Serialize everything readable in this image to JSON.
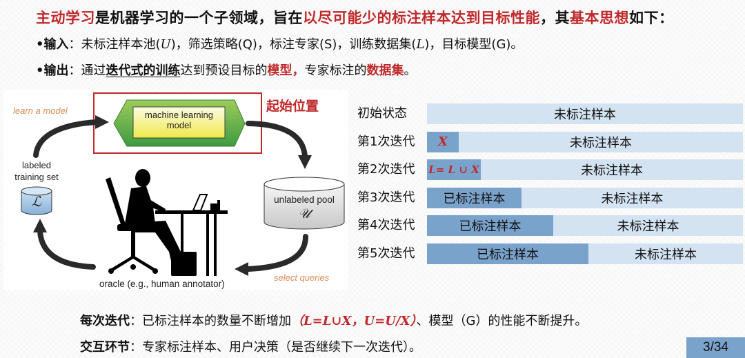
{
  "title": {
    "part1": "主动学习",
    "part2": "是机器学习的一个子领域，旨在",
    "part3": "以尽可能少的标注样本达到目标性能",
    "part4": "，其",
    "part5": "基本思想",
    "part6": "如下："
  },
  "input": {
    "bullet": "•",
    "label": "输入",
    "colon": "：",
    "text1": "未标注样本池(",
    "sym_u": "U",
    "text2": ")，筛选策略(Q)，标注专家(S)，训练数据集(",
    "sym_l": "L",
    "text3": ")，目标模型(G)。"
  },
  "output": {
    "bullet": "•",
    "label": "输出",
    "colon": "：",
    "text1": "通过",
    "underlined": "迭代式的训练",
    "text2": "达到预设目标的",
    "red1": "模型，",
    "text3": "专家标注的",
    "red2": "数据集",
    "text4": "。"
  },
  "diagram": {
    "learn_a_model": "learn a model",
    "model_label_line1": "machine learning",
    "model_label_line2": "model",
    "start_position": "起始位置",
    "labeled_line1": "labeled",
    "labeled_line2": "training set",
    "labeled_symbol": "ℒ",
    "unlabeled_label": "unlabeled pool",
    "unlabeled_symbol": "𝒰",
    "select_queries": "select queries",
    "oracle": "oracle (e.g., human annotator)"
  },
  "iterations": {
    "labeled_text": "已标注样本",
    "unlabeled_text": "未标注样本",
    "rows": [
      {
        "label": "初始状态",
        "labeled_fraction": 0.0,
        "labeled_content": ""
      },
      {
        "label": "第1次迭代",
        "labeled_fraction": 0.1,
        "labeled_content": "X"
      },
      {
        "label": "第2次迭代",
        "labeled_fraction": 0.17,
        "labeled_content": "L= L ∪ X"
      },
      {
        "label": "第3次迭代",
        "labeled_fraction": 0.3,
        "labeled_content": "已标注样本"
      },
      {
        "label": "第4次迭代",
        "labeled_fraction": 0.4,
        "labeled_content": "已标注样本"
      },
      {
        "label": "第5次迭代",
        "labeled_fraction": 0.51,
        "labeled_content": "已标注样本"
      }
    ]
  },
  "bottom": {
    "each_label": "每次迭代",
    "colon": "：",
    "each_text1": "已标注样本的数量不断增加",
    "each_formula": "（L=L∪X，U=U/X）",
    "each_text2": "、模型（G）的性能不断提升。",
    "interact_label": "交互环节",
    "interact_text": "专家标注样本、用户决策（是否继续下一次迭代）。"
  },
  "page": "3/34",
  "colors": {
    "accent_red": "#c0282a",
    "labeled_bar": "#7aa3cc",
    "unlabeled_bar": "#d3e3f2",
    "annotation_orange": "#d98b55"
  }
}
